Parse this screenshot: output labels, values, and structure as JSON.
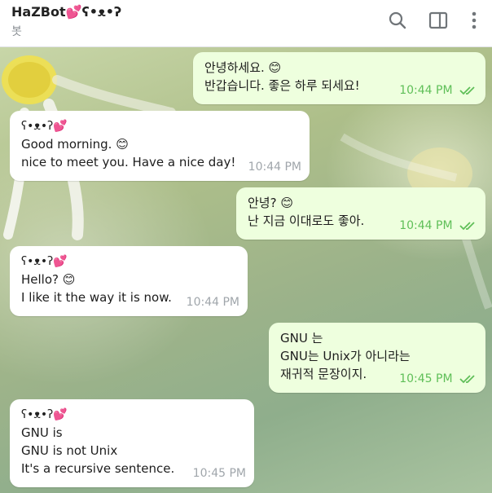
{
  "header": {
    "title": "HaZBot💕ʕ•ᴥ•ʔ",
    "subtitle": "봇",
    "icons": [
      "search-icon",
      "sidebar-toggle-icon",
      "more-vertical-icon"
    ]
  },
  "messages": [
    {
      "direction": "out",
      "lines": [
        "안녕하세요. 😊",
        "반갑습니다. 좋은 하루 되세요!"
      ],
      "time": "10:44 PM",
      "status": "read"
    },
    {
      "direction": "in",
      "sender": "ʕ•ᴥ•ʔ💕",
      "lines": [
        "Good morning. 😊",
        "nice to meet you. Have a nice day!"
      ],
      "time": "10:44 PM"
    },
    {
      "direction": "out",
      "lines": [
        "안녕? 😊",
        "난 지금 이대로도 좋아."
      ],
      "time": "10:44 PM",
      "status": "read"
    },
    {
      "direction": "in",
      "sender": "ʕ•ᴥ•ʔ💕",
      "lines": [
        "Hello? 😊",
        "I like it the way it is now."
      ],
      "time": "10:44 PM"
    },
    {
      "direction": "out",
      "lines": [
        "GNU 는",
        "GNU는 Unix가 아니라는",
        "재귀적 문장이지."
      ],
      "time": "10:45 PM",
      "status": "read"
    },
    {
      "direction": "in",
      "sender": "ʕ•ᴥ•ʔ💕",
      "lines": [
        "GNU is",
        "GNU is not Unix",
        "It's a recursive sentence."
      ],
      "time": "10:45 PM"
    }
  ],
  "colors": {
    "outgoing_bubble": "#eeffde",
    "incoming_bubble": "#ffffff",
    "read_check": "#5fbf58"
  }
}
